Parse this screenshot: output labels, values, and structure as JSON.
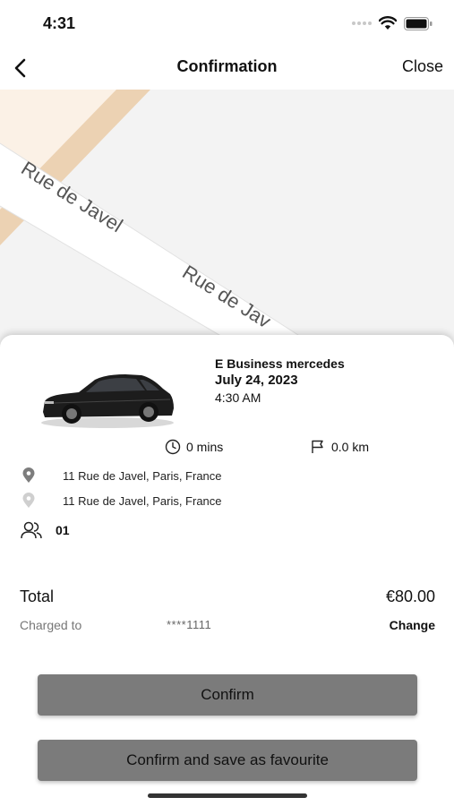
{
  "status_bar": {
    "time": "4:31"
  },
  "nav": {
    "title": "Confirmation",
    "close_label": "Close"
  },
  "map": {
    "street_1": "Rue de Javel",
    "street_2": "Rue de Jav"
  },
  "booking": {
    "vehicle_name": "E Business mercedes",
    "date": "July 24, 2023",
    "time": "4:30 AM",
    "duration": "0 mins",
    "distance": "0.0 km",
    "pickup_address": "11 Rue de Javel, Paris, France",
    "dropoff_address": "11 Rue de Javel, Paris, France",
    "passengers": "01"
  },
  "payment": {
    "total_label": "Total",
    "total_value": "€80.00",
    "charged_label": "Charged to",
    "card_mask": "****1111",
    "change_label": "Change"
  },
  "actions": {
    "confirm_label": "Confirm",
    "confirm_save_label": "Confirm and save as favourite"
  }
}
